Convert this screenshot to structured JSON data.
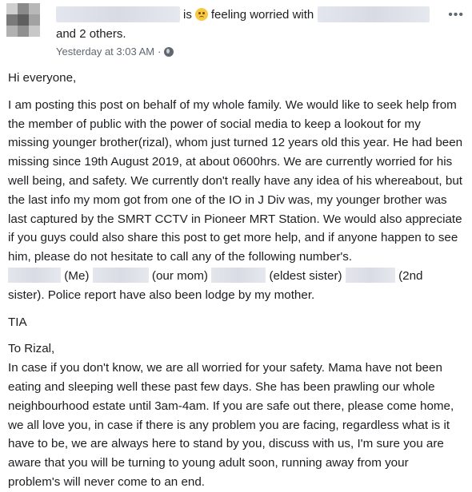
{
  "header": {
    "status_prefix": "is",
    "feeling_text": "feeling worried with",
    "others_text": "and 2 others.",
    "timestamp": "Yesterday at 3:03 AM",
    "separator": "·",
    "more_label": "•••",
    "icons": {
      "emoji": "worried-face-emoji",
      "privacy": "globe-icon",
      "more": "more-options-icon"
    }
  },
  "post": {
    "greeting": "Hi everyone,",
    "paragraph1": "I am posting this post on behalf of my whole family. We would like to seek help from the member of public with the power of social media to keep a lookout for my missing younger brother(rizal), whom just turned 12 years old this year. He had been missing since 19th August 2019, at about 0600hrs. We are currently worried for his well being, and safety. We currently don't really have any idea of his whereabout, but the last info my mom got from one of the IO in J Div was, my younger brother was last captured by the SMRT CCTV in Pioneer MRT Station. We would also appreciate if you guys could also share this post to get more help, and if anyone happen to see him, please do not hesitate to call any of the following number's.",
    "contacts": [
      "(Me)",
      "(our mom)",
      "(eldest sister)",
      "(2nd"
    ],
    "contacts_tail": "sister). Police report have also been lodge by my mother.",
    "tia": "TIA",
    "to_rizal": "To Rizal,",
    "paragraph2": "In case if you don't know, we are all worried for your safety. Mama have not been eating and sleeping well these past few days. She has been prawling our whole neighbourhood estate until 3am-4am. If you are safe out there, please come home, we all love you, in case if there is any problem you are facing, regardless what is it have to be, we are always here to stand by you, discuss with us, I'm sure you are aware that you will be turning to young adult soon, running away from your problem's will never come to an end."
  }
}
